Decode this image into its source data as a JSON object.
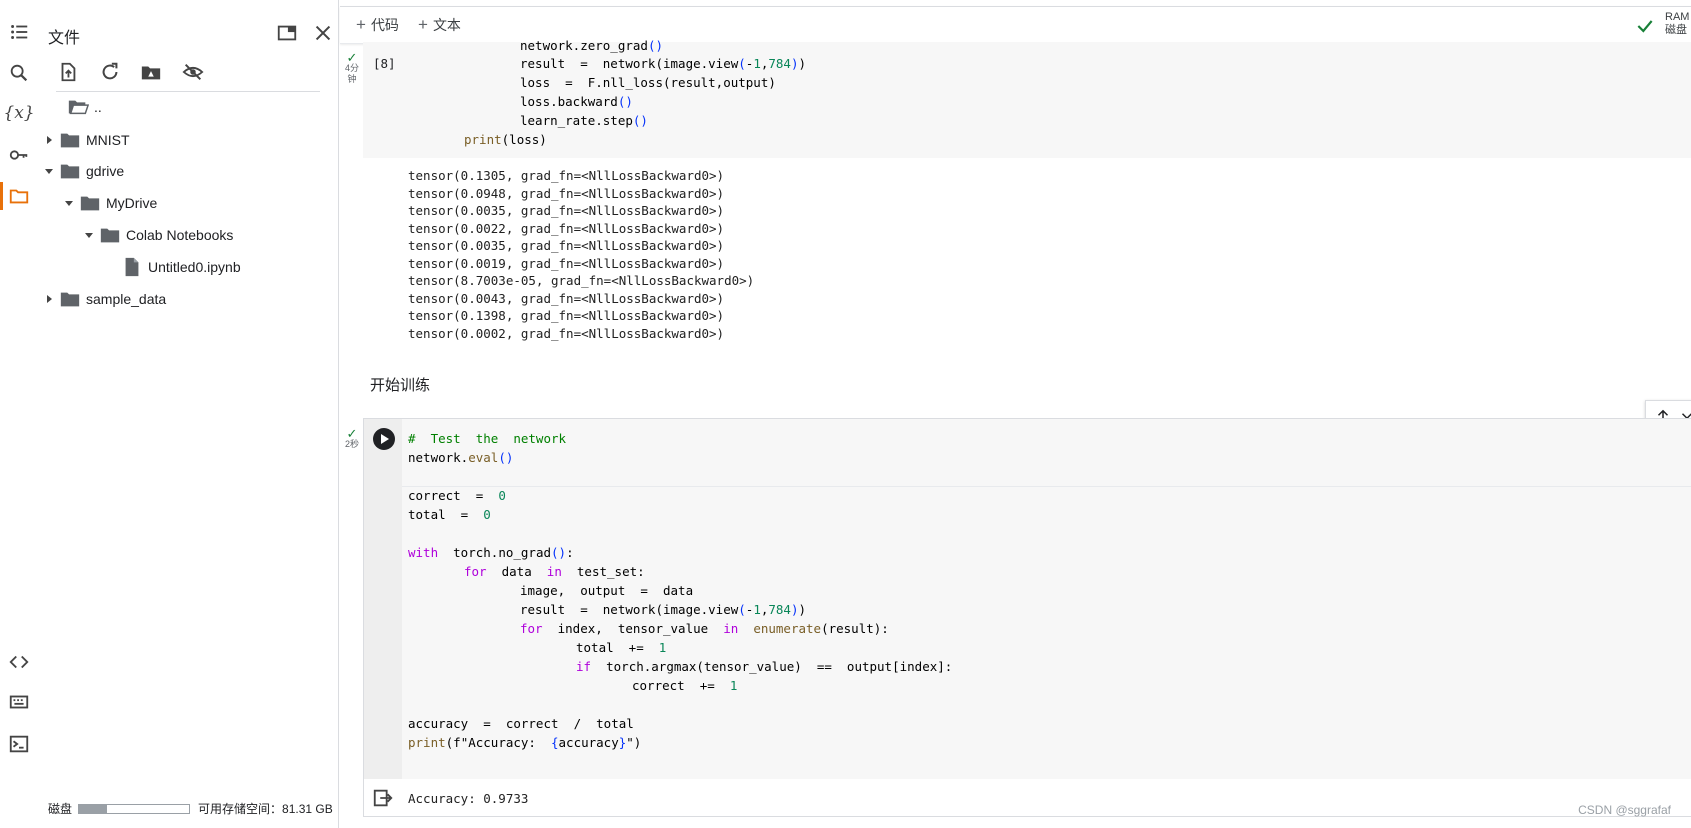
{
  "files_panel": {
    "title": "文件",
    "tree": [
      {
        "label": ".."
      },
      {
        "label": "MNIST"
      },
      {
        "label": "gdrive"
      },
      {
        "label": "MyDrive"
      },
      {
        "label": "Colab Notebooks"
      },
      {
        "label": "Untitled0.ipynb"
      },
      {
        "label": "sample_data"
      }
    ],
    "disk_label": "磁盘",
    "disk_usage_fraction": 0.25,
    "storage_text": "可用存储空间：81.31 GB"
  },
  "toolbar": {
    "add_code": "代码",
    "add_text": "文本",
    "ram_label": "RAM",
    "disk_label": "磁盘"
  },
  "cell1": {
    "exec_count": "[8]",
    "status_time": "4分钟",
    "lines": [
      "network.zero_grad()",
      "result = network(image.view(-1,784))",
      "loss = F.nll_loss(result,output)",
      "loss.backward()",
      "learn_rate.step()",
      "print(loss)"
    ],
    "outputs": [
      "tensor(0.1305, grad_fn=<NllLossBackward0>)",
      "tensor(0.0948, grad_fn=<NllLossBackward0>)",
      "tensor(0.0035, grad_fn=<NllLossBackward0>)",
      "tensor(0.0022, grad_fn=<NllLossBackward0>)",
      "tensor(0.0035, grad_fn=<NllLossBackward0>)",
      "tensor(0.0019, grad_fn=<NllLossBackward0>)",
      "tensor(8.7003e-05, grad_fn=<NllLossBackward0>)",
      "tensor(0.0043, grad_fn=<NllLossBackward0>)",
      "tensor(0.1398, grad_fn=<NllLossBackward0>)",
      "tensor(0.0002, grad_fn=<NllLossBackward0>)"
    ]
  },
  "text_cell": {
    "heading": "开始训练"
  },
  "cell2": {
    "status_time": "2秒",
    "output": "Accuracy: 0.9733"
  },
  "watermark": "CSDN @sggrafaf"
}
